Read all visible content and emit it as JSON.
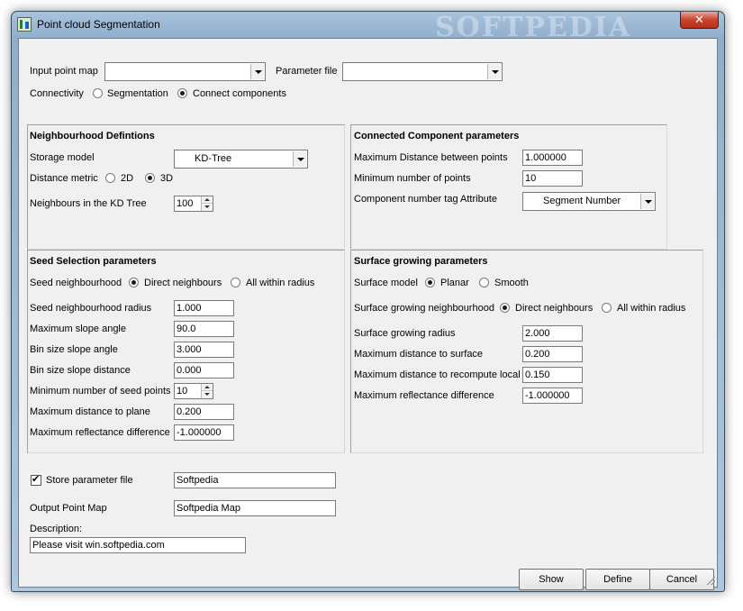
{
  "window": {
    "title": "Point cloud Segmentation",
    "watermark": "SOFTPEDIA",
    "close_glyph": "✕"
  },
  "top": {
    "input_point_map_label": "Input point map",
    "input_point_map_value": "",
    "parameter_file_label": "Parameter file",
    "parameter_file_value": "",
    "connectivity_label": "Connectivity",
    "segmentation_label": "Segmentation",
    "connect_components_label": "Connect components",
    "connectivity_selected": "Connect components"
  },
  "neighbourhood": {
    "title": "Neighbourhood Defintions",
    "storage_model_label": "Storage model",
    "storage_model_value": "KD-Tree",
    "distance_metric_label": "Distance metric",
    "opt_2d": "2D",
    "opt_3d": "3D",
    "distance_metric_selected": "3D",
    "neighbours_label": "Neighbours in the KD Tree",
    "neighbours_value": "100"
  },
  "connected": {
    "title": "Connected Component parameters",
    "max_distance_label": "Maximum Distance between points",
    "max_distance_value": "1.000000",
    "min_points_label": "Minimum number of points",
    "min_points_value": "10",
    "tag_attribute_label": "Component number tag Attribute",
    "tag_attribute_value": "Segment Number"
  },
  "seed": {
    "title": "Seed Selection parameters",
    "neighbourhood_label": "Seed neighbourhood",
    "direct_label": "Direct neighbours",
    "radius_label": "All within radius",
    "neighbourhood_selected": "Direct neighbours",
    "rows": [
      {
        "label": "Seed neighbourhood radius",
        "value": "1.000"
      },
      {
        "label": "Maximum slope angle",
        "value": "90.0"
      },
      {
        "label": "Bin size slope angle",
        "value": "3.000"
      },
      {
        "label": "Bin size slope distance",
        "value": "0.000"
      },
      {
        "label": "Minimum number of seed points",
        "value": "10"
      },
      {
        "label": "Maximum distance to plane",
        "value": "0.200"
      },
      {
        "label": "Maximum reflectance difference",
        "value": "-1.000000"
      }
    ]
  },
  "surface": {
    "title": "Surface growing parameters",
    "model_label": "Surface model",
    "planar_label": "Planar",
    "smooth_label": "Smooth",
    "model_selected": "Planar",
    "neighbourhood_label": "Surface growing neighbourhood",
    "direct_label": "Direct neighbours",
    "radius_label": "All within radius",
    "neighbourhood_selected": "Direct neighbours",
    "rows": [
      {
        "label": "Surface growing radius",
        "value": "2.000"
      },
      {
        "label": "Maximum distance to surface",
        "value": "0.200"
      },
      {
        "label": "Maximum distance to recompute local",
        "value": "0.150"
      },
      {
        "label": "Maximum reflectance difference",
        "value": "-1.000000"
      }
    ]
  },
  "output": {
    "store_parameter_label": "Store parameter file",
    "store_parameter_checked": true,
    "store_parameter_value": "Softpedia",
    "output_point_map_label": "Output Point Map",
    "output_point_map_value": "Softpedia Map",
    "description_label": "Description:",
    "description_value": "Please visit win.softpedia.com"
  },
  "buttons": {
    "show": "Show",
    "define": "Define",
    "cancel": "Cancel"
  }
}
